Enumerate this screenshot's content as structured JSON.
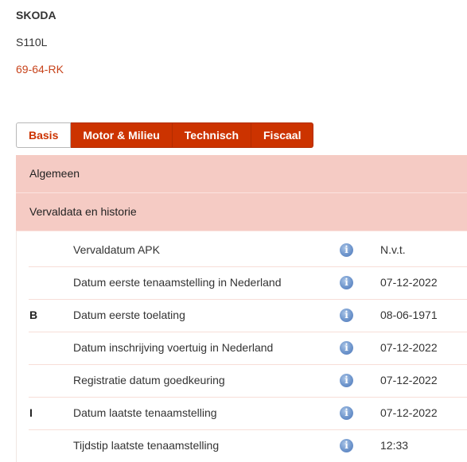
{
  "vehicle": {
    "make": "SKODA",
    "model": "S110L",
    "plate": "69-64-RK"
  },
  "tabs": [
    {
      "label": "Basis",
      "active": true
    },
    {
      "label": "Motor & Milieu",
      "active": false
    },
    {
      "label": "Technisch",
      "active": false
    },
    {
      "label": "Fiscaal",
      "active": false
    }
  ],
  "sections": {
    "general": "Algemeen",
    "expiry_history": "Vervaldata en historie"
  },
  "info_icon": "info-icon",
  "info_glyph": "i",
  "rows": [
    {
      "code": "",
      "label": "Vervaldatum APK",
      "value": "N.v.t."
    },
    {
      "code": "",
      "label": "Datum eerste tenaamstelling in Nederland",
      "value": "07-12-2022"
    },
    {
      "code": "B",
      "label": "Datum eerste toelating",
      "value": "08-06-1971"
    },
    {
      "code": "",
      "label": "Datum inschrijving voertuig in Nederland",
      "value": "07-12-2022"
    },
    {
      "code": "",
      "label": "Registratie datum goedkeuring",
      "value": "07-12-2022"
    },
    {
      "code": "I",
      "label": "Datum laatste tenaamstelling",
      "value": "07-12-2022"
    },
    {
      "code": "",
      "label": "Tijdstip laatste tenaamstelling",
      "value": "12:33"
    }
  ],
  "colors": {
    "accent": "#cc3300",
    "plate": "#c8441c",
    "section_bg": "#f5cbc4",
    "info_icon": "#6e95cc"
  }
}
